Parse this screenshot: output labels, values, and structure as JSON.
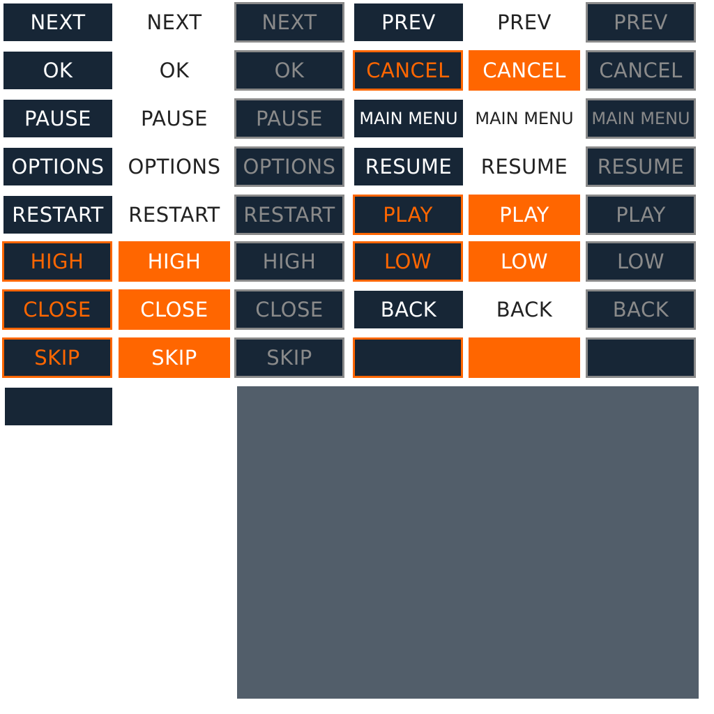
{
  "sprite_sheet": {
    "rows": [
      [
        "NEXT",
        "NEXT",
        "NEXT",
        "PREV",
        "PREV",
        "PREV"
      ],
      [
        "OK",
        "OK",
        "OK",
        "CANCEL",
        "CANCEL",
        "CANCEL"
      ],
      [
        "PAUSE",
        "PAUSE",
        "PAUSE",
        "MAIN MENU",
        "MAIN MENU",
        "MAIN MENU"
      ],
      [
        "OPTIONS",
        "OPTIONS",
        "OPTIONS",
        "RESUME",
        "RESUME",
        "RESUME"
      ],
      [
        "RESTART",
        "RESTART",
        "RESTART",
        "PLAY",
        "PLAY",
        "PLAY"
      ],
      [
        "HIGH",
        "HIGH",
        "HIGH",
        "LOW",
        "LOW",
        "LOW"
      ],
      [
        "CLOSE",
        "CLOSE",
        "CLOSE",
        "BACK",
        "BACK",
        "BACK"
      ],
      [
        "SKIP",
        "SKIP",
        "SKIP",
        "",
        "",
        ""
      ],
      [
        ""
      ]
    ],
    "styles": [
      [
        "dark",
        "plain",
        "disabled",
        "dark",
        "plain",
        "disabled"
      ],
      [
        "dark",
        "plain",
        "disabled",
        "dark-hl",
        "orange",
        "disabled"
      ],
      [
        "dark",
        "plain",
        "disabled",
        "dark",
        "plain",
        "disabled"
      ],
      [
        "dark",
        "plain",
        "disabled",
        "dark",
        "plain",
        "disabled"
      ],
      [
        "dark",
        "plain",
        "disabled",
        "dark-hl",
        "orange",
        "disabled"
      ],
      [
        "dark-hl",
        "orange",
        "disabled",
        "dark-hl",
        "orange",
        "disabled"
      ],
      [
        "dark-hl",
        "orange",
        "disabled",
        "dark",
        "plain",
        "disabled"
      ],
      [
        "dark-hl",
        "orange",
        "disabled",
        "dark-hl",
        "orange",
        "disabled"
      ],
      [
        "dark"
      ]
    ],
    "colors": {
      "dark_navy": "#172636",
      "accent_orange": "#ff6600",
      "disabled_gray": "#8a8a8a",
      "panel_slate": "#525e6a",
      "background": "#ffffff"
    }
  }
}
